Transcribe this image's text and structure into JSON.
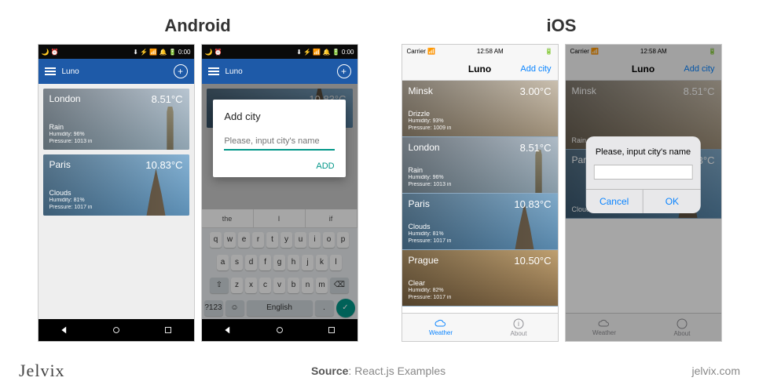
{
  "platforms": {
    "android": "Android",
    "ios": "iOS"
  },
  "android": {
    "status_icons_left": "🌙 ⏰",
    "status_icons_right": "⬇ ⚡ 📶 🔔 🔋 0:00",
    "app_title": "Luno",
    "cities": [
      {
        "name": "London",
        "temp": "8.51°C",
        "cond": "Rain",
        "humidity": "Humidity: 96%",
        "pressure": "Pressure: 1013 in",
        "bg": "london"
      },
      {
        "name": "Paris",
        "temp": "10.83°C",
        "cond": "Clouds",
        "humidity": "Humidity: 81%",
        "pressure": "Pressure: 1017 in",
        "bg": "paris"
      }
    ],
    "dialog": {
      "title": "Add city",
      "placeholder": "Please, input city's name",
      "action": "ADD"
    },
    "dim_card": {
      "temp": "10.83°C"
    },
    "suggestions": [
      "the",
      "I",
      "if"
    ],
    "kbd_rows": [
      [
        "q",
        "w",
        "e",
        "r",
        "t",
        "y",
        "u",
        "i",
        "o",
        "p"
      ],
      [
        "a",
        "s",
        "d",
        "f",
        "g",
        "h",
        "j",
        "k",
        "l"
      ],
      [
        "⇧",
        "z",
        "x",
        "c",
        "v",
        "b",
        "n",
        "m",
        "⌫"
      ]
    ],
    "kbd_bottom": {
      "sym": "?123",
      "lang": "English"
    }
  },
  "ios": {
    "carrier": "Carrier",
    "time": "12:58 AM",
    "app_title": "Luno",
    "add_city": "Add city",
    "tabs": {
      "weather": "Weather",
      "about": "About"
    },
    "cities": [
      {
        "name": "Minsk",
        "temp": "3.00°C",
        "cond": "Drizzle",
        "humidity": "Humidity: 93%",
        "pressure": "Pressure: 1009 in",
        "bg": "minsk"
      },
      {
        "name": "London",
        "temp": "8.51°C",
        "cond": "Rain",
        "humidity": "Humidity: 96%",
        "pressure": "Pressure: 1013 in",
        "bg": "london"
      },
      {
        "name": "Paris",
        "temp": "10.83°C",
        "cond": "Clouds",
        "humidity": "Humidity: 81%",
        "pressure": "Pressure: 1017 in",
        "bg": "paris"
      },
      {
        "name": "Prague",
        "temp": "10.50°C",
        "cond": "Clear",
        "humidity": "Humidity: 82%",
        "pressure": "Pressure: 1017 in",
        "bg": "prague"
      }
    ],
    "dim_cities": [
      {
        "name": "Minsk",
        "temp": "8.51°C",
        "cond": "Rain",
        "bg": "minsk"
      },
      {
        "name": "Paris",
        "temp": "10.83°C",
        "cond": "Clouds",
        "bg": "paris"
      }
    ],
    "dialog": {
      "msg": "Please, input city's name",
      "cancel": "Cancel",
      "ok": "OK"
    }
  },
  "footer": {
    "brand": "Jelvix",
    "source_label": "Source",
    "source_value": "React.js Examples",
    "site": "jelvix.com"
  }
}
